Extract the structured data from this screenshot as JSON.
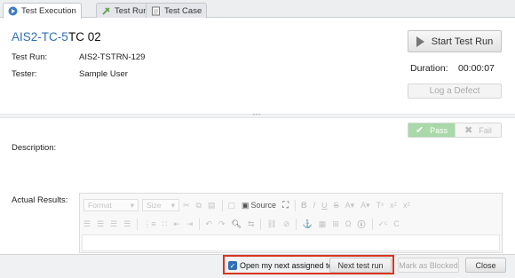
{
  "tabs": [
    {
      "label": "Test Execution",
      "icon": "play-circle-icon",
      "active": true
    },
    {
      "label": "Test Run Details",
      "icon": "wrench-icon",
      "active": false
    },
    {
      "label": "Test Case",
      "icon": "document-icon",
      "active": false
    }
  ],
  "header": {
    "test_id": "AIS2-TC-5",
    "test_name": "TC 02"
  },
  "info": {
    "test_run_label": "Test Run:",
    "test_run_value": "AIS2-TSTRN-129",
    "tester_label": "Tester:",
    "tester_value": "Sample User"
  },
  "actions": {
    "start_label": "Start Test Run",
    "duration_label": "Duration:",
    "duration_value": "00:00:07",
    "log_defect_label": "Log a Defect"
  },
  "result": {
    "pass_label": "Pass",
    "fail_label": "Fail"
  },
  "fields": {
    "description_label": "Description:",
    "actual_results_label": "Actual Results:"
  },
  "editor": {
    "format_label": "Format",
    "size_label": "Size",
    "source_label": "Source"
  },
  "footer": {
    "open_next_label": "Open my next assigned test",
    "open_next_checked": true,
    "next_run_label": "Next test run",
    "mark_blocked_label": "Mark as Blocked",
    "close_label": "Close"
  },
  "colors": {
    "link_blue": "#2f6fb5",
    "highlight_red": "#d9341f",
    "pass_green": "#a9d8a9"
  }
}
